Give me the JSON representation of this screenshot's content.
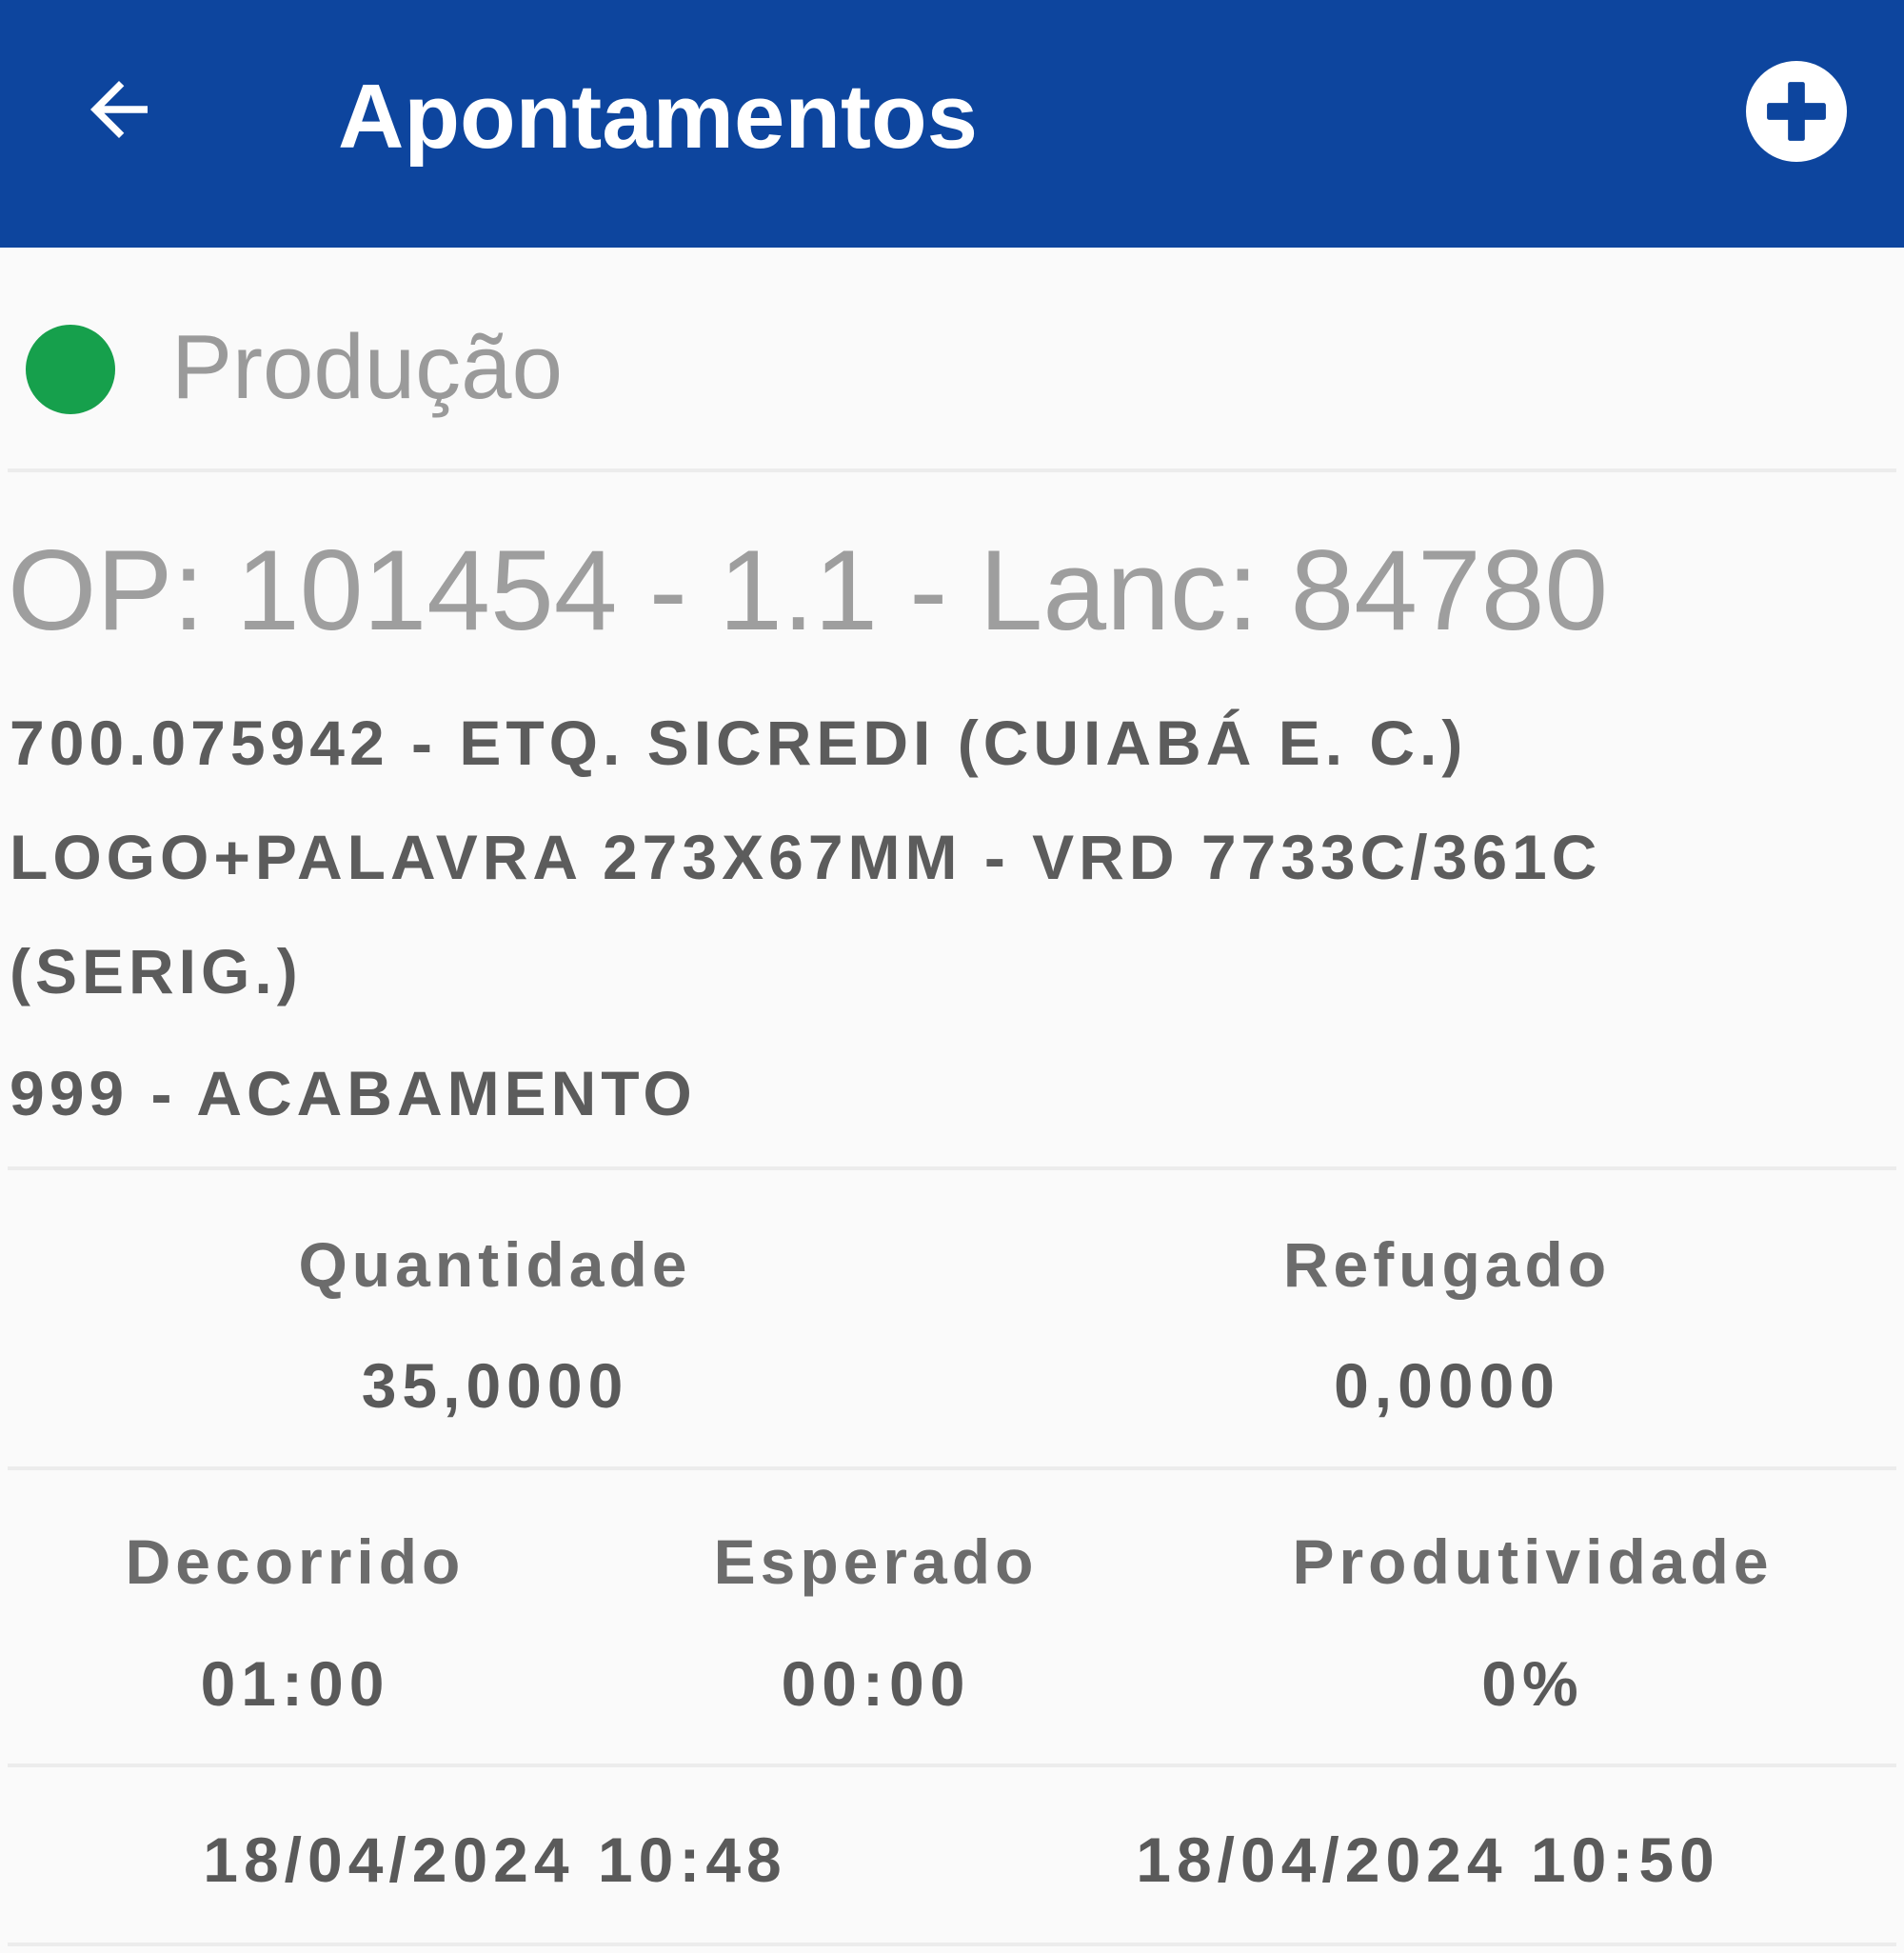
{
  "appbar": {
    "back_icon": "arrow-left-icon",
    "title": "Apontamentos",
    "add_icon": "plus-circle-icon",
    "background_color": "#0d459e"
  },
  "status": {
    "label": "Produção",
    "color": "#16a04c"
  },
  "order": {
    "title": "OP: 101454 - 1.1 - Lanc: 84780",
    "product_line1": "700.075942 - ETQ. SICREDI (CUIABÁ E. C.)",
    "product_line2": "LOGO+PALAVRA 273X67MM - VRD 7733C/361C",
    "product_line3": "(SERIG.)",
    "operation": "999 - ACABAMENTO"
  },
  "quantities": {
    "quantidade_label": "Quantidade",
    "quantidade_value": "35,0000",
    "refugado_label": "Refugado",
    "refugado_value": "0,0000"
  },
  "times": {
    "decorrido_label": "Decorrido",
    "decorrido_value": "01:00",
    "esperado_label": "Esperado",
    "esperado_value": "00:00",
    "produtividade_label": "Produtividade",
    "produtividade_value": "0%"
  },
  "period": {
    "start": "18/04/2024 10:48",
    "end": "18/04/2024 10:50"
  }
}
